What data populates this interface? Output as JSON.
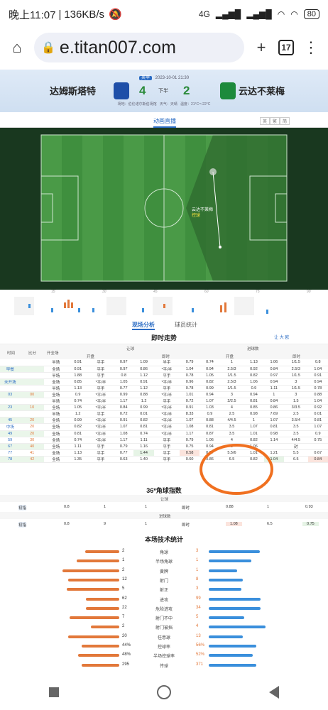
{
  "status": {
    "time": "晚上11:07",
    "speed": "136KB/s",
    "net": "4G",
    "battery": "80"
  },
  "browser": {
    "url": "e.titan007.com",
    "tabs": "17"
  },
  "match": {
    "tag": "英甲",
    "datetime": "2023-10-01 21:30",
    "home": "达姆斯塔特",
    "away": "云达不莱梅",
    "home_score": "4",
    "away_score": "2",
    "period": "下半",
    "venue": "场地：伯伦诺尔斯伯场馆",
    "weather": "天气：天晴",
    "temp": "温度：21°C～22°C"
  },
  "live": {
    "label": "动画直播",
    "b1": "英",
    "b2": "繁",
    "b3": "简",
    "pitch_team": "云达不莱梅",
    "pitch_event": "控球"
  },
  "timeline": {
    "ticks": [
      "15'",
      "30'",
      "45'",
      "60'",
      "75'",
      "90'"
    ]
  },
  "tabs": {
    "t1": "现场分析",
    "t2": "球员统计"
  },
  "odds": {
    "title": "即时走势",
    "legend": [
      "让",
      "大",
      "欧"
    ],
    "head1": [
      "",
      "",
      "",
      "让球",
      "",
      "",
      "",
      "进球数",
      "",
      ""
    ],
    "head2": [
      "时间",
      "比分",
      "开全场",
      "开盘",
      "",
      "即时",
      "",
      "开盘",
      "",
      "即时"
    ],
    "rows": [
      [
        "",
        "",
        "半场",
        "0.91",
        "平手",
        "0.97",
        "1.09",
        "半手",
        "0.79",
        "0.74",
        "1",
        "1.13",
        "1.06",
        "1/1.5",
        "0.8"
      ],
      [
        "早餐",
        "",
        "全场",
        "0.91",
        "平手",
        "0.97",
        "0.86",
        "*平/半",
        "1.04",
        "0.94",
        "2.5/3",
        "0.92",
        "0.84",
        "2.5/3",
        "1.04"
      ],
      [
        "",
        "",
        "半场",
        "1.88",
        "平手",
        "0.8",
        "1.12",
        "平手",
        "0.78",
        "1.05",
        "1/1.5",
        "0.82",
        "0.97",
        "1/1.5",
        "0.91"
      ],
      [
        "未开场",
        "",
        "全场",
        "0.85",
        "*平/半",
        "1.05",
        "0.91",
        "*平/半",
        "0.96",
        "0.82",
        "2.5/3",
        "1.06",
        "0.94",
        "3",
        "0.94"
      ],
      [
        "",
        "",
        "半场",
        "1.13",
        "平手",
        "0.77",
        "1.12",
        "平手",
        "0.78",
        "0.99",
        "1/1.5",
        "0.9",
        "1.11",
        "1/1.5",
        "0.78"
      ],
      [
        "03",
        "00",
        "全场",
        "0.9",
        "*平/半",
        "0.99",
        "0.88",
        "*平/半",
        "1.01",
        "0.94",
        "3",
        "0.94",
        "1",
        "3",
        "0.88"
      ],
      [
        "",
        "",
        "半场",
        "0.74",
        "*平/半",
        "1.17",
        "1.2",
        "平手",
        "0.72",
        "1.07",
        "2/2.5",
        "0.81",
        "0.84",
        "1.5",
        "1.04"
      ],
      [
        "23",
        "10",
        "全场",
        "1.05",
        "*平/半",
        "0.84",
        "0.99",
        "*平/半",
        "0.91",
        "1.03",
        "4",
        "0.85",
        "0.86",
        "3/3.5",
        "0.92"
      ],
      [
        "",
        "",
        "半场",
        "1.2",
        "平手",
        "0.72",
        "0.01",
        "*平/半",
        "8.33",
        "0.9",
        "2.5",
        "0.98",
        "7.69",
        "2.5",
        "0.01"
      ],
      [
        "45",
        "20",
        "全场",
        "0.99",
        "*平/半",
        "0.91",
        "0.82",
        "*平/半",
        "1.07",
        "0.88",
        "4/4.5",
        "1",
        "1.07",
        "3.5/4",
        "0.81"
      ],
      [
        "中场",
        "20",
        "全场",
        "0.82",
        "*平/半",
        "1.07",
        "0.81",
        "*平/半",
        "1.08",
        "0.81",
        "3.5",
        "1.07",
        "0.81",
        "3.5",
        "1.07"
      ],
      [
        "49",
        "20",
        "全场",
        "0.81",
        "*平/半",
        "1.08",
        "0.74",
        "*平/半",
        "1.17",
        "0.87",
        "3.5",
        "1.01",
        "0.98",
        "3.5",
        "0.9"
      ],
      [
        "59",
        "30",
        "全场",
        "0.74",
        "*平/半",
        "1.17",
        "1.11",
        "平手",
        "0.79",
        "1.06",
        "4",
        "0.82",
        "1.14",
        "4/4.5",
        "0.75"
      ],
      [
        "67",
        "40",
        "全场",
        "1.11",
        "平手",
        "0.79",
        "1.16",
        "平手",
        "0.75",
        "0.94",
        "5",
        "1.06",
        "",
        "封",
        ""
      ],
      [
        "77",
        "41",
        "全场",
        "1.13",
        "平手",
        "0.77",
        "1.44",
        "平手",
        "0.58",
        "0.87",
        "5.5/6",
        "1.01",
        "1.21",
        "5.5",
        "0.67"
      ],
      [
        "78",
        "42",
        "全场",
        "1.35",
        "平手",
        "0.63",
        "1.40",
        "平手",
        "0.60",
        "0.86",
        "6.5",
        "0.82",
        "1.04",
        "6.5",
        "0.84"
      ]
    ]
  },
  "corner": {
    "title": "36*角球指数",
    "sub1": "让球",
    "sub2": "进球数",
    "r1": [
      "初指",
      "0.8",
      "1",
      "1",
      "即时",
      "0.88",
      "1",
      "0.93"
    ],
    "r2": [
      "初指",
      "0.8",
      "9",
      "1",
      "即时",
      "1.08",
      "6.5",
      "0.75"
    ]
  },
  "tech": {
    "title": "本场技术统计",
    "rows": [
      {
        "label": "角球",
        "l": "2",
        "r": "3",
        "lf": 0.4,
        "rf": 0.6
      },
      {
        "label": "半场角球",
        "l": "1",
        "r": "1",
        "lf": 0.5,
        "rf": 0.5
      },
      {
        "label": "黄牌",
        "l": "2",
        "r": "1",
        "lf": 0.67,
        "rf": 0.33
      },
      {
        "label": "射门",
        "l": "12",
        "r": "8",
        "lf": 0.6,
        "rf": 0.4
      },
      {
        "label": "射正",
        "l": "5",
        "r": "3",
        "lf": 0.62,
        "rf": 0.38
      },
      {
        "label": "进攻",
        "l": "62",
        "r": "99",
        "lf": 0.39,
        "rf": 0.61
      },
      {
        "label": "危险进攻",
        "l": "22",
        "r": "34",
        "lf": 0.39,
        "rf": 0.61
      },
      {
        "label": "射门不中",
        "l": "7",
        "r": "5",
        "lf": 0.58,
        "rf": 0.42
      },
      {
        "label": "射门被挡",
        "l": "2",
        "r": "4",
        "lf": 0.33,
        "rf": 0.67
      },
      {
        "label": "任意球",
        "l": "20",
        "r": "13",
        "lf": 0.6,
        "rf": 0.4
      },
      {
        "label": "控球率",
        "l": "44%",
        "r": "56%",
        "lf": 0.44,
        "rf": 0.56
      },
      {
        "label": "半场控球率",
        "l": "48%",
        "r": "52%",
        "lf": 0.48,
        "rf": 0.52
      },
      {
        "label": "传球",
        "l": "295",
        "r": "371",
        "lf": 0.44,
        "rf": 0.56
      }
    ]
  },
  "colors": {
    "home": "#e2783a",
    "away": "#3a8fdc",
    "accent": "#2b6cc4",
    "circle": "#f07020"
  }
}
